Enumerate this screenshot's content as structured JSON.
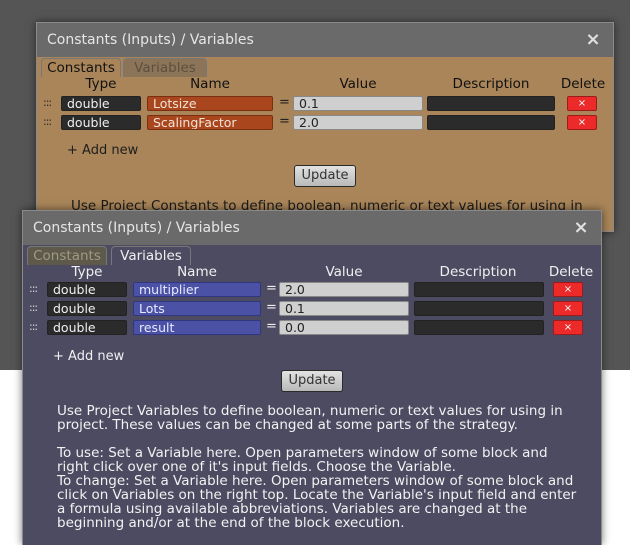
{
  "back_window": {
    "title": "Constants (Inputs) / Variables",
    "tabs": [
      {
        "label": "Constants",
        "active": true
      },
      {
        "label": "Variables",
        "active": false
      }
    ],
    "headers": {
      "type": "Type",
      "name": "Name",
      "value": "Value",
      "description": "Description",
      "delete": "Delete"
    },
    "rows": [
      {
        "type": "double",
        "name": "Lotsize",
        "value": "0.1",
        "description": ""
      },
      {
        "type": "double",
        "name": "ScalingFactor",
        "value": "2.0",
        "description": ""
      }
    ],
    "add_new": "+ Add new",
    "update_label": "Update",
    "help_text": "Use Project Constants to define boolean, numeric or text values for using in"
  },
  "front_window": {
    "title": "Constants (Inputs) / Variables",
    "tabs": [
      {
        "label": "Constants",
        "active": false
      },
      {
        "label": "Variables",
        "active": true
      }
    ],
    "headers": {
      "type": "Type",
      "name": "Name",
      "value": "Value",
      "description": "Description",
      "delete": "Delete"
    },
    "rows": [
      {
        "type": "double",
        "name": "multiplier",
        "value": "2.0",
        "description": ""
      },
      {
        "type": "double",
        "name": "Lots",
        "value": "0.1",
        "description": ""
      },
      {
        "type": "double",
        "name": "result",
        "value": "0.0",
        "description": ""
      }
    ],
    "add_new": "+ Add new",
    "update_label": "Update",
    "help_lines": [
      "Use Project Variables to define boolean, numeric or text values for using in",
      "project. These values can be changed at some parts of the strategy.",
      "",
      "To use: Set a Variable here. Open parameters window of some block and",
      "right click over one of it's input fields. Choose the Variable.",
      "To change: Set a Variable here. Open parameters window of some block and",
      "click on Variables on the right top. Locate the Variable's input field and enter",
      "a formula using available abbreviations. Variables are changed at the",
      "beginning and/or at the end of the block execution."
    ]
  },
  "common": {
    "equals": "=",
    "delete_glyph": "×",
    "grip_glyph": ":::",
    "close_glyph": "×"
  },
  "colors": {
    "constant_name": "#a9461e",
    "variable_name": "#4b52a6",
    "delete": "#ec2a2a",
    "back_bg": "#a98559",
    "front_bg": "#4c4b62"
  }
}
